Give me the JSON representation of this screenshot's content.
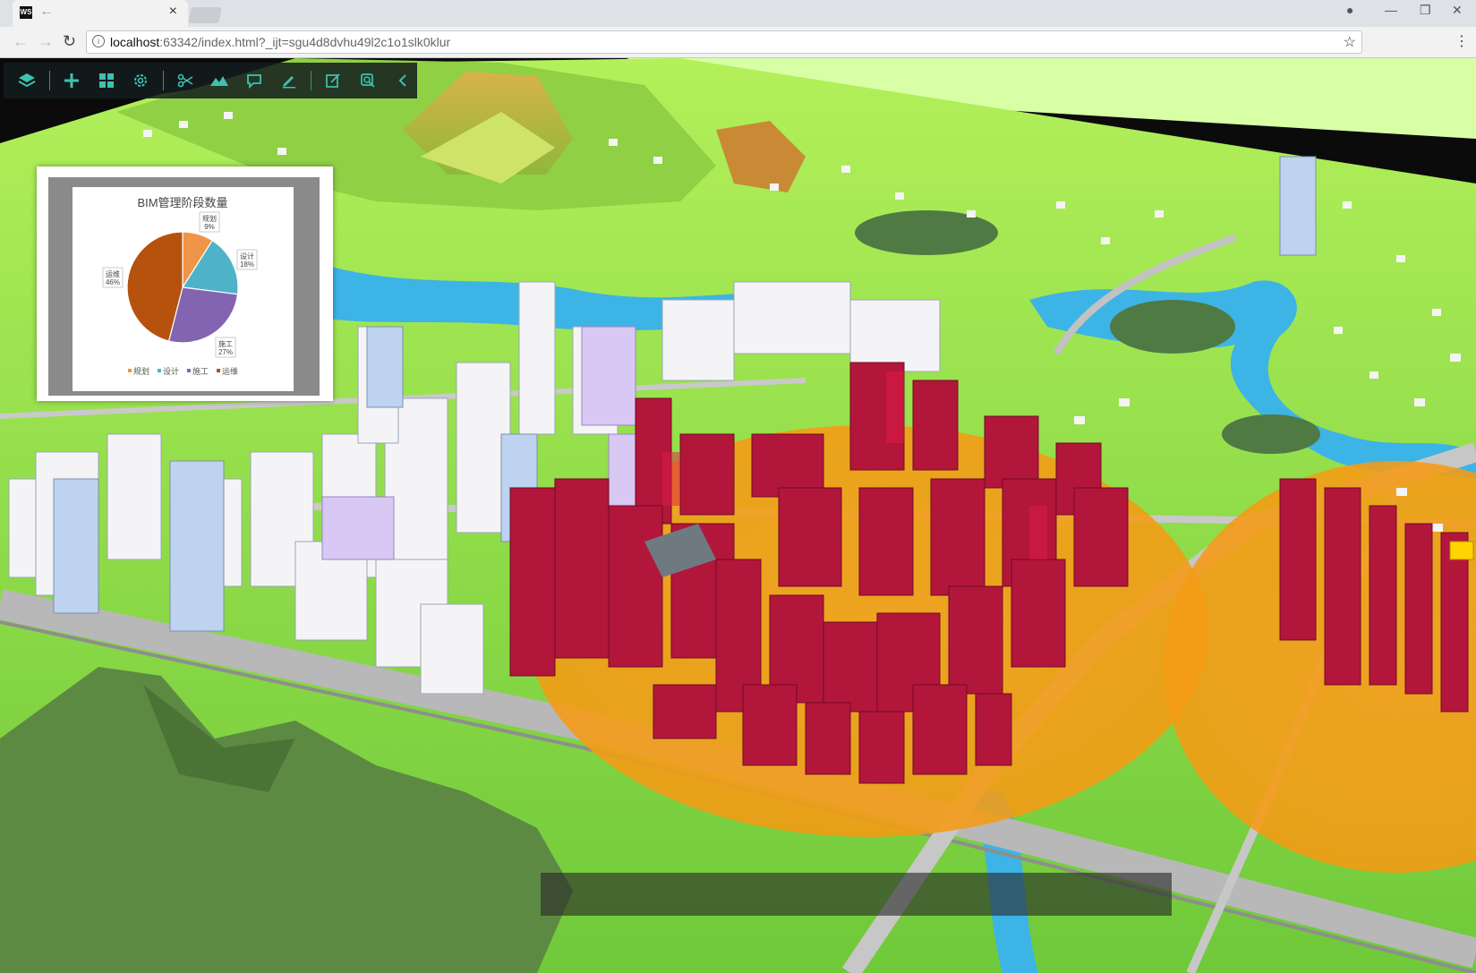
{
  "browser": {
    "favicon_text": "WS",
    "tab_close": "×",
    "url_host": "localhost",
    "url_rest": ":63342/index.html?_ijt=sgu4d8dvhu49l2c1o1slk0klur",
    "back_glyph": "←",
    "forward_glyph": "→",
    "reload_glyph": "↻",
    "star_glyph": "☆",
    "kebab_glyph": "⋮",
    "window_controls": [
      "—",
      "❐",
      "✕"
    ],
    "profile_glyph": "●"
  },
  "map_toolbar": {
    "buttons": [
      {
        "name": "layers-icon",
        "glyph": "layers"
      },
      {
        "name": "add-icon",
        "glyph": "plus"
      },
      {
        "name": "grid-icon",
        "glyph": "grid"
      },
      {
        "name": "settings-icon",
        "glyph": "gear"
      },
      {
        "name": "scissors-icon",
        "glyph": "scissors"
      },
      {
        "name": "terrain-icon",
        "glyph": "terrain"
      },
      {
        "name": "chat-icon",
        "glyph": "chat"
      },
      {
        "name": "pen-icon",
        "glyph": "pen"
      },
      {
        "name": "edit-icon",
        "glyph": "edit"
      },
      {
        "name": "search-icon",
        "glyph": "search"
      },
      {
        "name": "collapse-icon",
        "glyph": "chevron-left"
      }
    ],
    "icon_color": "#3fc1b0"
  },
  "chart_data": {
    "type": "pie",
    "title": "BIM管理阶段数量",
    "categories": [
      "规划",
      "设计",
      "施工",
      "运维"
    ],
    "values": [
      9,
      18,
      27,
      46
    ],
    "labels": [
      "9%",
      "18%",
      "27%",
      "46%"
    ],
    "colors": [
      "#ee9547",
      "#4eb3c9",
      "#8264b0",
      "#b6510e"
    ],
    "legend_position": "bottom"
  },
  "scene_colors": {
    "sky": "#0b0b0b",
    "ground_far": "#d8ff9a",
    "grass": "#8ee04a",
    "water": "#3db4e6",
    "road": "#b7b7b7",
    "highlight_zone": "#f7a21a",
    "highlight_building": "#b3163b",
    "mountain": "#5d8a42"
  }
}
